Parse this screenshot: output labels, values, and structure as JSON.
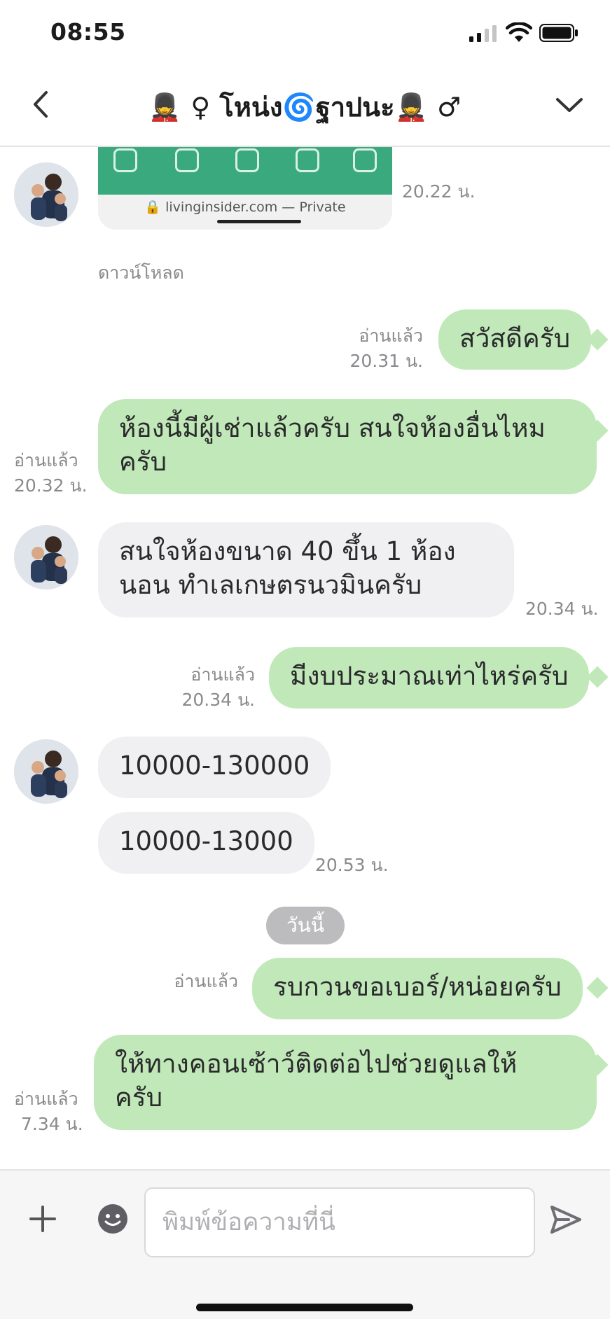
{
  "status_bar": {
    "time": "08:55"
  },
  "header": {
    "title": "💂 ♀ โหน่ง🌀ฐาปนะ💂 ♂"
  },
  "messages": [
    {
      "side": "in",
      "type": "image",
      "image_url_text": "🔒 livinginsider.com — Private",
      "time": "20.22 น.",
      "download_label": "ดาวน์โหลด"
    },
    {
      "side": "out",
      "text": "สวัสดีครับ",
      "read": "อ่านแล้ว",
      "time": "20.31 น."
    },
    {
      "side": "out",
      "text_lines": [
        "ห้องนี้มีผู้เช่าแล้วครับ สนใจห้องอื่นไหม",
        "ครับ"
      ],
      "read": "อ่านแล้ว",
      "time": "20.32 น."
    },
    {
      "side": "in",
      "text_lines": [
        "สนใจห้องขนาด 40 ขึ้น 1 ห้อง",
        "นอน ทำเลเกษตรนวมินครับ"
      ],
      "time": "20.34 น."
    },
    {
      "side": "out",
      "text": "มีงบประมาณเท่าไหร่ครับ",
      "read": "อ่านแล้ว",
      "time": "20.34 น."
    },
    {
      "side": "in",
      "text": "10000-130000"
    },
    {
      "side": "in",
      "text": "10000-13000",
      "time": "20.53 น."
    },
    {
      "side": "out",
      "text": "รบกวนขอเบอร์/หน่อยครับ",
      "read": "อ่านแล้ว"
    },
    {
      "side": "out",
      "text_lines": [
        "ให้ทางคอนเซ้าว์ติดต่อไปช่วยดูแลให้",
        "ครับ"
      ],
      "read": "อ่านแล้ว",
      "time": "7.34 น."
    }
  ],
  "date_separator": "วันนี้",
  "composer": {
    "placeholder": "พิมพ์ข้อความที่นี่"
  },
  "colors": {
    "outgoing_bubble": "#c0e8b8",
    "incoming_bubble": "#f0f0f2",
    "meta_text": "#8a8a8e"
  },
  "icons": [
    "back-arrow",
    "chevron-down",
    "plus",
    "emoji",
    "send",
    "signal",
    "wifi",
    "battery"
  ]
}
